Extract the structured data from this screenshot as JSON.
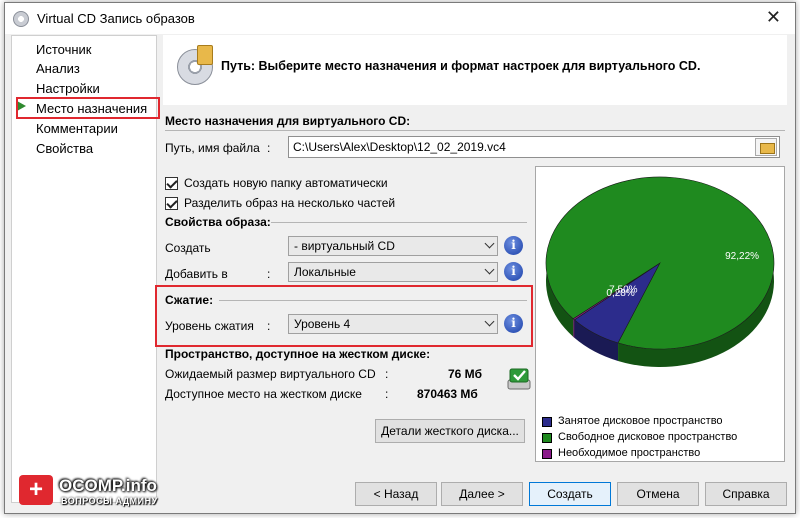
{
  "window": {
    "title": "Virtual CD Запись образов",
    "close_glyph": "✕"
  },
  "nav": {
    "items": [
      "Источник",
      "Анализ",
      "Настройки",
      "Место назначения",
      "Комментарии",
      "Свойства"
    ],
    "selected_index": 3
  },
  "header": {
    "text": "Путь: Выберите место назначения и формат настроек для виртуального CD."
  },
  "destination": {
    "title": "Место назначения для виртуального CD:",
    "path_label": "Путь, имя файла",
    "colon": ":",
    "path_value": "C:\\Users\\Alex\\Desktop\\12_02_2019.vc4",
    "create_folder_label": "Создать новую папку автоматически",
    "split_label": "Разделить образ на несколько частей",
    "create_folder_checked": true,
    "split_checked": true
  },
  "image_props": {
    "title": "Свойства образа:",
    "create_label": "Создать",
    "create_value": "- виртуальный CD",
    "add_label": "Добавить в",
    "add_colon": ":",
    "add_value": "Локальные"
  },
  "compression": {
    "title": "Сжатие:",
    "level_label": "Уровень сжатия",
    "colon": ":",
    "level_value": "Уровень 4"
  },
  "space": {
    "title": "Пространство, доступное на жестком диске:",
    "expected_label": "Ожидаемый размер виртуального CD",
    "expected_colon": ":",
    "expected_value": "76 Мб",
    "free_label": "Доступное место на жестком диске",
    "free_colon": ":",
    "free_value": "870463 Мб",
    "details_button": "Детали жесткого диска..."
  },
  "chart_data": {
    "type": "pie",
    "slices": [
      {
        "label": "Занятое дисковое пространство",
        "value": 7.5,
        "color": "#2c2c8c",
        "label_text": "7,50%"
      },
      {
        "label": "Свободное дисковое пространство",
        "value": 92.22,
        "color": "#1f8a1f",
        "label_text": "92,22%"
      },
      {
        "label": "Необходимое пространство",
        "value": 0.28,
        "color": "#8a1a8a",
        "label_text": "0,28%"
      }
    ]
  },
  "buttons": {
    "back": "< Назад",
    "next": "Далее >",
    "create": "Создать",
    "cancel": "Отмена",
    "help": "Справка"
  },
  "watermark": {
    "brand": "OCOMP.info",
    "sub": "ВОПРОСЫ АДМИНУ"
  },
  "info_glyph": "i"
}
